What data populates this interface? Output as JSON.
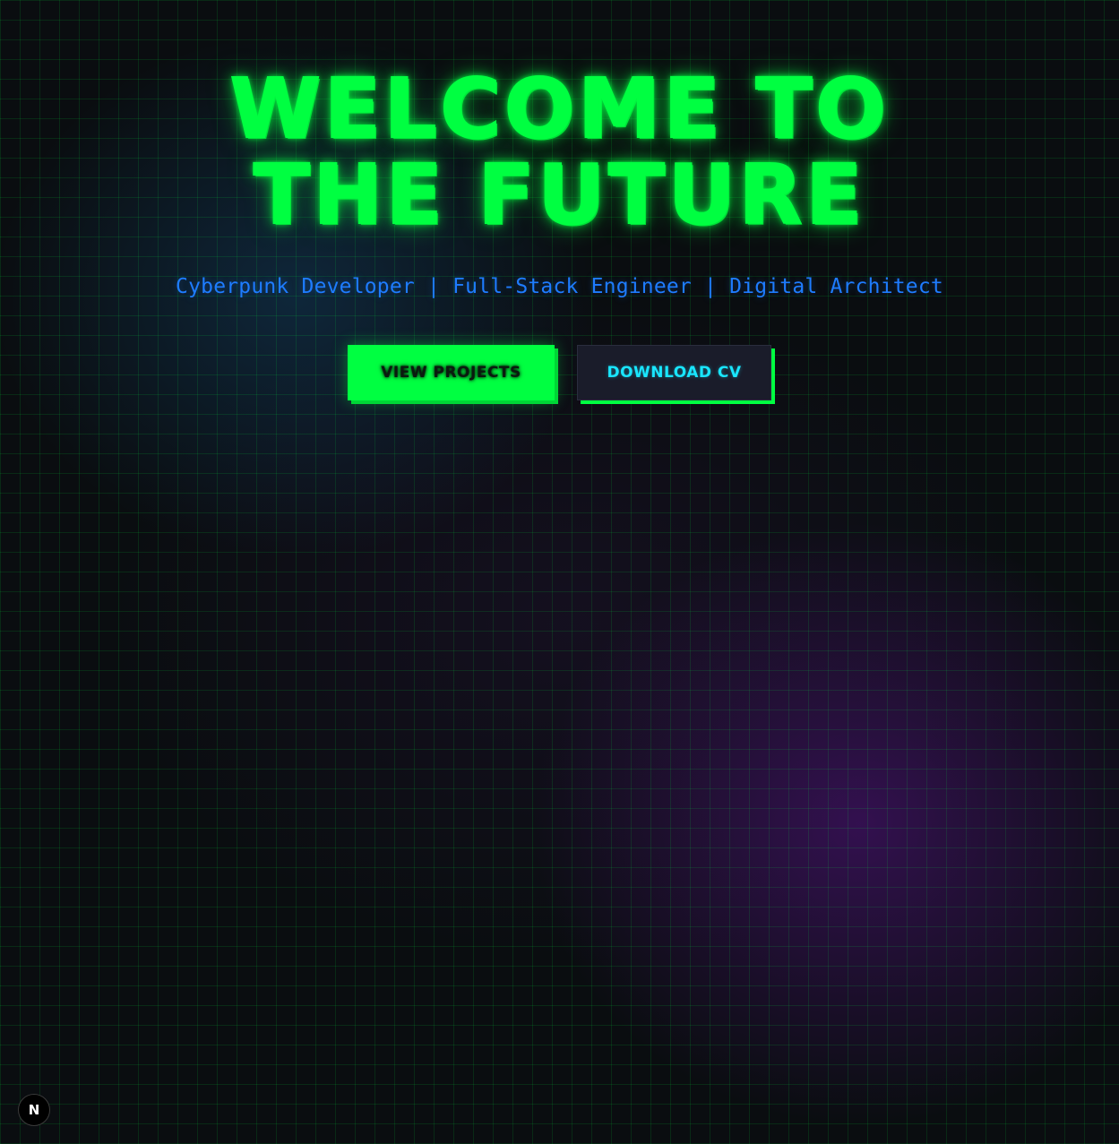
{
  "hero": {
    "title_line1": "WELCOME TO",
    "title_line2": "THE FUTURE",
    "subtitle": "Cyberpunk Developer | Full-Stack Engineer | Digital Architect"
  },
  "actions": {
    "primary_label": "VIEW PROJECTS",
    "secondary_label": "DOWNLOAD CV"
  },
  "dev_badge": {
    "label": "N",
    "icon": "nextjs-logo-icon"
  },
  "colors": {
    "neon_green": "#00ff41",
    "subtitle_blue": "#1e7cff",
    "cyan": "#19e6ff",
    "background": "#0a0d10"
  }
}
